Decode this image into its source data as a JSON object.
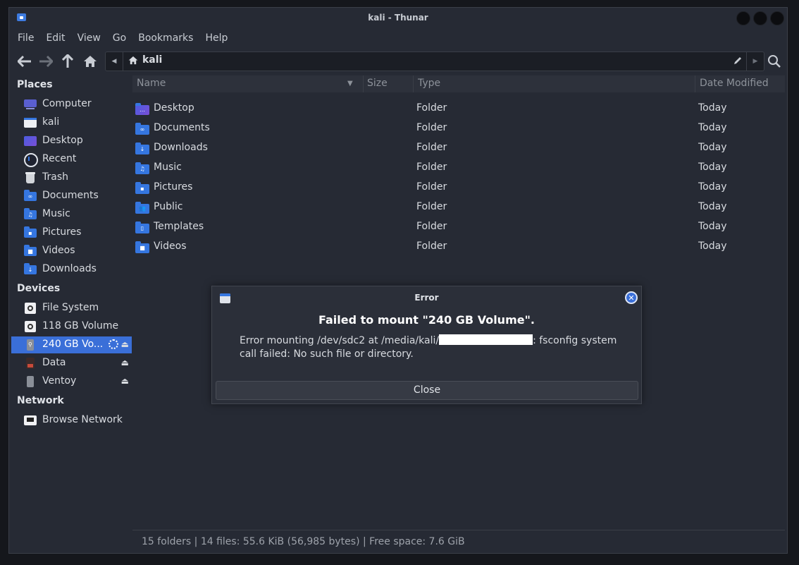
{
  "window": {
    "title": "kali - Thunar"
  },
  "menu": [
    "File",
    "Edit",
    "View",
    "Go",
    "Bookmarks",
    "Help"
  ],
  "pathbar": {
    "crumb": "kali"
  },
  "sidebar": {
    "places_label": "Places",
    "places": [
      "Computer",
      "kali",
      "Desktop",
      "Recent",
      "Trash",
      "Documents",
      "Music",
      "Pictures",
      "Videos",
      "Downloads"
    ],
    "devices_label": "Devices",
    "devices": [
      "File System",
      "118 GB Volume",
      "240 GB Vo...",
      "Data",
      "Ventoy"
    ],
    "network_label": "Network",
    "network": [
      "Browse Network"
    ]
  },
  "columns": {
    "name": "Name",
    "size": "Size",
    "type": "Type",
    "date": "Date Modified"
  },
  "files": [
    {
      "name": "Desktop",
      "type": "Folder",
      "date": "Today"
    },
    {
      "name": "Documents",
      "type": "Folder",
      "date": "Today"
    },
    {
      "name": "Downloads",
      "type": "Folder",
      "date": "Today"
    },
    {
      "name": "Music",
      "type": "Folder",
      "date": "Today"
    },
    {
      "name": "Pictures",
      "type": "Folder",
      "date": "Today"
    },
    {
      "name": "Public",
      "type": "Folder",
      "date": "Today"
    },
    {
      "name": "Templates",
      "type": "Folder",
      "date": "Today"
    },
    {
      "name": "Videos",
      "type": "Folder",
      "date": "Today"
    }
  ],
  "status": "15 folders | 14 files: 55.6 KiB (56,985 bytes) | Free space: 7.6 GiB",
  "dialog": {
    "title": "Error",
    "heading": "Failed to mount \"240 GB Volume\".",
    "message_start": "Error mounting /dev/sdc2 at /media/kali/",
    "message_end": ": fsconfig system call failed: No such file or directory.",
    "close_label": "Close"
  },
  "colors": {
    "accent": "#3a6fd8",
    "folder": "#3576e0",
    "window_bg": "#262a34"
  }
}
